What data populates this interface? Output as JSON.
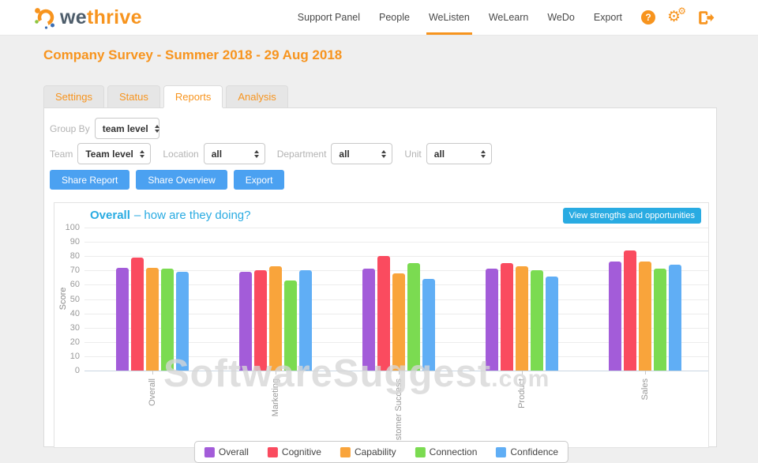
{
  "brand": {
    "we": "we",
    "thrive": "thrive"
  },
  "nav": {
    "items": [
      {
        "label": "Support Panel",
        "active": false
      },
      {
        "label": "People",
        "active": false
      },
      {
        "label": "WeListen",
        "active": true
      },
      {
        "label": "WeLearn",
        "active": false
      },
      {
        "label": "WeDo",
        "active": false
      },
      {
        "label": "Export",
        "active": false
      }
    ],
    "help_glyph": "?"
  },
  "page": {
    "title": "Company Survey - Summer 2018 - 29 Aug 2018"
  },
  "tabs": [
    {
      "label": "Settings",
      "active": false
    },
    {
      "label": "Status",
      "active": false
    },
    {
      "label": "Reports",
      "active": true
    },
    {
      "label": "Analysis",
      "active": false
    }
  ],
  "filters": {
    "rows": [
      [
        {
          "label": "Group By",
          "value": "team level"
        }
      ],
      [
        {
          "label": "Team",
          "value": "Team level"
        },
        {
          "label": "Location",
          "value": "all"
        },
        {
          "label": "Department",
          "value": "all"
        },
        {
          "label": "Unit",
          "value": "all"
        }
      ]
    ]
  },
  "action_buttons": [
    "Share Report",
    "Share Overview",
    "Export"
  ],
  "chart_header": {
    "title_strong": "Overall",
    "title_rest": "– how are they doing?",
    "action": "View strengths and opportunities"
  },
  "watermark": {
    "text": "SoftwareSuggest",
    "suffix": ".com"
  },
  "colors": {
    "brand_orange": "#f7941e",
    "chart_blue": "#29abe2",
    "button_blue": "#4ba1f1"
  },
  "chart_data": {
    "type": "bar",
    "title": "Overall – how are they doing?",
    "xlabel": "",
    "ylabel": "Score",
    "ylim": [
      0,
      100
    ],
    "ytick_step": 10,
    "grid": true,
    "legend_position": "bottom",
    "categories": [
      "Overall",
      "Marketing",
      "Customer Success",
      "Product",
      "Sales"
    ],
    "series": [
      {
        "name": "Overall",
        "color": "#a35cd9",
        "values": [
          72,
          69,
          71,
          71,
          76
        ]
      },
      {
        "name": "Cognitive",
        "color": "#fa4b5f",
        "values": [
          79,
          70,
          80,
          75,
          84
        ]
      },
      {
        "name": "Capability",
        "color": "#f9a43b",
        "values": [
          72,
          73,
          68,
          73,
          76
        ]
      },
      {
        "name": "Connection",
        "color": "#7bdb51",
        "values": [
          71,
          63,
          75,
          70,
          71
        ]
      },
      {
        "name": "Confidence",
        "color": "#60aef5",
        "values": [
          69,
          70,
          64,
          66,
          74
        ]
      }
    ]
  }
}
